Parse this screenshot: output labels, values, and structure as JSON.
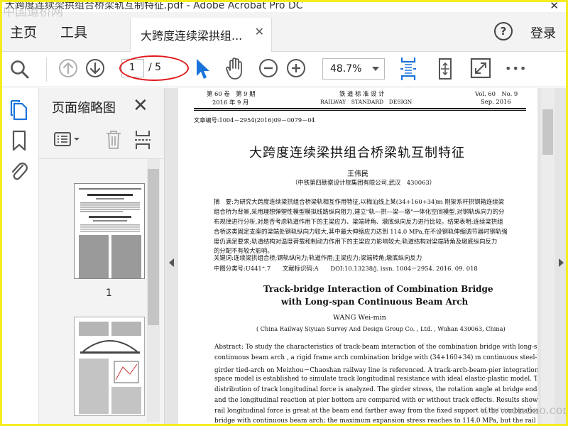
{
  "window": {
    "title": "大跨度连续梁拱组合桥梁轨互制特征.pdf - Adobe Acrobat Pro DC",
    "close_glyph": "✕"
  },
  "menu": {
    "home": "主页",
    "tools": "工具",
    "tab_label": "大跨度连续梁拱组...",
    "tab_close": "✕",
    "help": "?",
    "login": "登录"
  },
  "toolbar": {
    "current_page": "1",
    "total_pages": "/ 5",
    "zoom": "48.7%",
    "more": "•••"
  },
  "panel": {
    "title": "页面缩略图",
    "close": "✕",
    "thumb1_label": "1"
  },
  "document": {
    "header_left_1": "第 60 卷　第 9 期",
    "header_left_2": "2016 年 9 月",
    "header_center_1": "铁 道 标 准 设 计",
    "header_center_2": "RAILWAY　STANDARD　DESIGN",
    "header_right_1": "Vol. 60　No. 9",
    "header_right_2": "Sep.  2016",
    "article_no": "文章编号:1004－2954(2016)09－0079－04",
    "title_cn": "大跨度连续梁拱组合桥梁轨互制特征",
    "author_cn": "王伟民",
    "affiliation_cn": "（中铁第四勘察设计院集团有限公司,武汉　430063）",
    "abstract_cn": [
      "摘　要:为研究大跨度连续梁拱组合桥梁轨相互作用特征,以梅汕线上某(34+160+34)m 刚架系杆拱钢箱连续梁",
      "组合桥为背景,采用理想弹塑性模型模拟线路纵向阻力,建立\"轨—拱—梁—墩\"一体化空间模型,对钢轨纵向力的分",
      "布规律进行分析,对是否考虑轨道作用下的主梁应力、梁端转角、墩底纵向反力进行比较。结果表明:连续梁拱组",
      "合桥这类固定支座的梁端处钢轨纵向力较大,其中最大伸缩应力达到 114.0 MPa,在不设钢轨伸缩调节器时钢轨强",
      "度仍满足要求;轨道结构对温度荷载和制动力作用下的主梁应力影响较大;轨道结构对梁端转角及墩底纵向反力",
      "的分配不有较大影响。"
    ],
    "keywords_cn": "关键词:连续梁拱组合桥;钢轨纵向力;轨道作用;主梁应力;梁端转角;墩底纵向反力",
    "class_line": "中图分类号:U441⁺.7　　文献标识码:A　　DOI:10.13238/j. issn. 1004－2954. 2016. 09. 018",
    "title_en_1": "Track-bridge Interaction of Combination Bridge",
    "title_en_2": "with Long-span Continuous Beam Arch",
    "author_en": "WANG Wei-min",
    "affiliation_en": "( China Railway Siyuan Survey And Design Group Co. , Ltd. , Wuhan 430063, China)",
    "abstract_en": [
      "Abstract: To study the characteristics of track-beam interaction of the combination bridge with long-span",
      "continuous beam arch , a rigid frame arch combination bridge with (34+160+34) m continuous steel-box",
      "girder tied-arch on Meizhou－Chaoshan railway line is referenced.  A track-arch-beam-pier integration",
      "space model is established to simulate track longitudinal resistance with ideal elastic-plastic model. The",
      "distribution of track longitudinal force is analyzed.  The girder stress, the rotation angle at bridge end,",
      "and the longitudinal reaction at pier bottom are compared with or without track effects.  Results show that",
      "rail longitudinal force is great at the beam end farther away from the fixed support of the combination",
      "bridge with continuous beam arch;  the maximum expansion stress reaches to 114.0 MPa,  but the rail"
    ]
  },
  "watermarks": {
    "top": "中国道桥网",
    "bottom": "www.cndao.com"
  },
  "colors": {
    "accent_blue": "#1a73d9",
    "annotation_red": "#e0191b",
    "frame_yellow": "#f5ec1f"
  }
}
